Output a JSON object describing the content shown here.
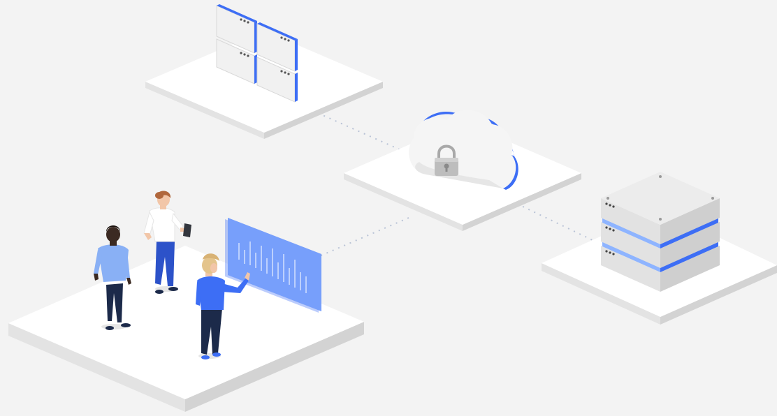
{
  "scene": {
    "description_free": true,
    "colors": {
      "background": "#f3f3f3",
      "platform_top": "#ffffff",
      "platform_left": "#e3e3e3",
      "platform_right": "#d3d3d3",
      "accent_blue": "#3d6ef5",
      "light_blue": "#8eb4ff",
      "panel_face": "#e9edf7",
      "cloud": "#f5f5f5",
      "lock_gray": "#a9a9a9",
      "skin_dark": "#3b2a22",
      "skin_light": "#f2c6a8",
      "hair_red": "#b0673c",
      "hair_blond": "#e4c48c",
      "shirt_light_blue": "#89b0f5",
      "shirt_white": "#ffffff",
      "pants_navy": "#1c2a4a",
      "connector": "#b9c3d6"
    },
    "icons": [
      "window-panels-icon",
      "cloud-lock-icon",
      "server-stack-icon",
      "data-dashboard-icon",
      "people-icon"
    ]
  }
}
